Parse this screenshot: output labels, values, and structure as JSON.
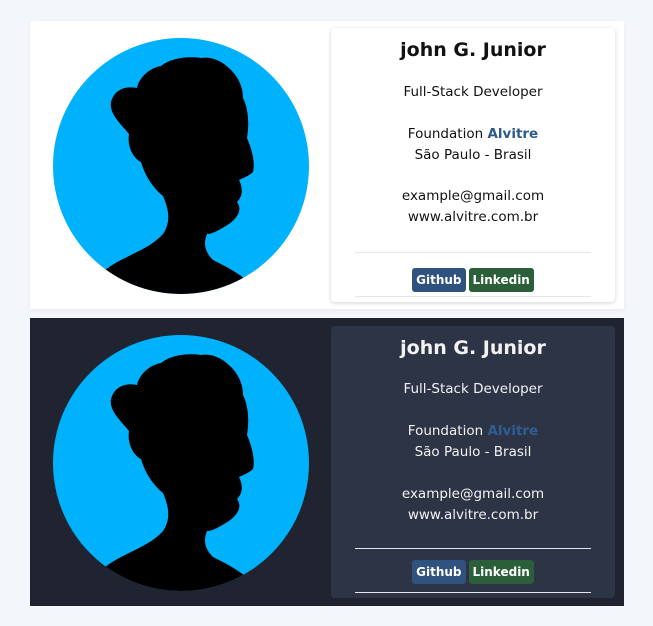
{
  "cards": [
    {
      "theme": "light",
      "name": "john G. Junior",
      "role": "Full-Stack Developer",
      "company_prefix": "Foundation",
      "company_name": "Alvitre",
      "location": "São Paulo - Brasil",
      "email": "example@gmail.com",
      "website": "www.alvitre.com.br",
      "buttons": {
        "github": "Github",
        "linkedin": "Linkedin"
      }
    },
    {
      "theme": "dark",
      "name": "john G. Junior",
      "role": "Full-Stack Developer",
      "company_prefix": "Foundation",
      "company_name": "Alvitre",
      "location": "São Paulo - Brasil",
      "email": "example@gmail.com",
      "website": "www.alvitre.com.br",
      "buttons": {
        "github": "Github",
        "linkedin": "Linkedin"
      }
    }
  ],
  "colors": {
    "avatar_bg": "#00b1fc",
    "brand": "#2c5a8c",
    "github_button": "#30527f",
    "linkedin_button": "#2a5f3a",
    "dark_card_bg": "#1f2430",
    "dark_info_bg": "#2c3446"
  },
  "icons": {
    "avatar": "person-silhouette"
  }
}
